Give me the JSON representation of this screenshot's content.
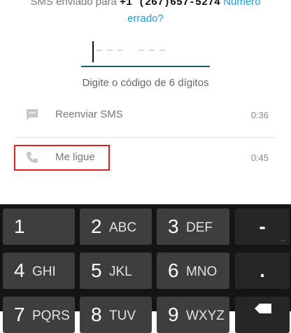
{
  "header": {
    "sms_prefix": "SMS enviado para ",
    "phone": "+1 (267)657-5274",
    "wrong_number_part1": "Número",
    "wrong_number_part2": "errado?"
  },
  "code_input": {
    "placeholder": "––– –––"
  },
  "hint": "Digite o código de 6 dígitos",
  "actions": [
    {
      "label": "Reenviar SMS",
      "timer": "0:36",
      "icon": "message-icon"
    },
    {
      "label": "Me ligue",
      "timer": "0:45",
      "icon": "phone-icon"
    }
  ],
  "colors": {
    "accent": "#1a9bd7",
    "underline": "#176066",
    "highlight": "#e0201d",
    "keyboard_bg": "#141414",
    "key_bg": "#3d3e3d"
  },
  "keypad": {
    "rows": [
      [
        {
          "digit": "1",
          "letters": ""
        },
        {
          "digit": "2",
          "letters": "ABC"
        },
        {
          "digit": "3",
          "letters": "DEF"
        },
        {
          "symbol": "-"
        }
      ],
      [
        {
          "digit": "4",
          "letters": "GHI"
        },
        {
          "digit": "5",
          "letters": "JKL"
        },
        {
          "digit": "6",
          "letters": "MNO"
        },
        {
          "symbol": "."
        }
      ],
      [
        {
          "digit": "7",
          "letters": "PQRS"
        },
        {
          "digit": "8",
          "letters": "TUV"
        },
        {
          "digit": "9",
          "letters": "WXYZ"
        },
        {
          "symbol": "backspace"
        }
      ]
    ],
    "minus_hint": "..."
  }
}
